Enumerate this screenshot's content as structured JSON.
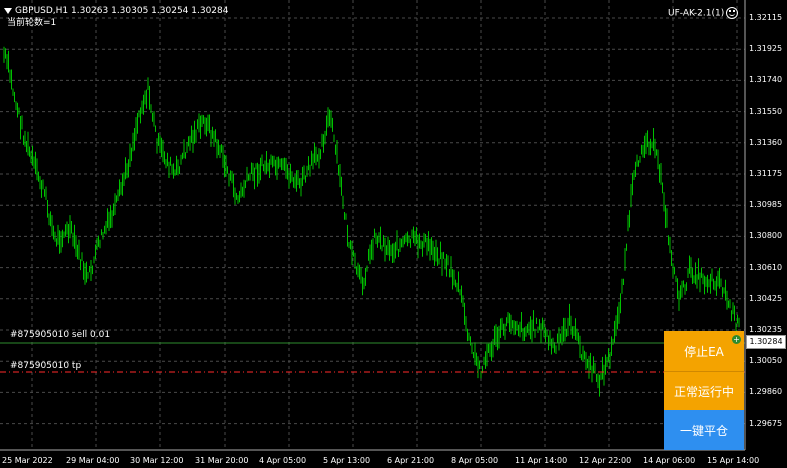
{
  "chart": {
    "symbol_line": "GBPUSD,H1  1.30263 1.30305 1.30254 1.30284",
    "counter_line": "当前轮数=1",
    "ea_label": "UF-AK-2.1(1)",
    "current_price": "1.30284",
    "price_axis": [
      "1.32115",
      "1.31925",
      "1.31740",
      "1.31550",
      "1.31360",
      "1.31175",
      "1.30985",
      "1.30800",
      "1.30610",
      "1.30425",
      "1.30235",
      "1.30050",
      "1.29860",
      "1.29675"
    ],
    "time_axis": [
      "25 Mar 2022",
      "29 Mar 04:00",
      "30 Mar 12:00",
      "31 Mar 20:00",
      "4 Apr 05:00",
      "5 Apr 13:00",
      "6 Apr 21:00",
      "8 Apr 05:00",
      "11 Apr 14:00",
      "12 Apr 22:00",
      "14 Apr 06:00",
      "15 Apr 14:00"
    ],
    "order_sell_label": "#875905010 sell 0.01",
    "order_tp_label": "#875905010 tp",
    "colors": {
      "bars": "#00c000",
      "grid": "#4a4a4a",
      "sell_line": "#2e8b2e",
      "tp_line": "#ff2a2a"
    }
  },
  "panel": {
    "stop_ea": "停止EA",
    "status": "正常运行中",
    "close_all": "一键平仓",
    "colors": {
      "stop": "#f4a300",
      "status": "#f4a300",
      "close": "#2e8ff0"
    }
  }
}
